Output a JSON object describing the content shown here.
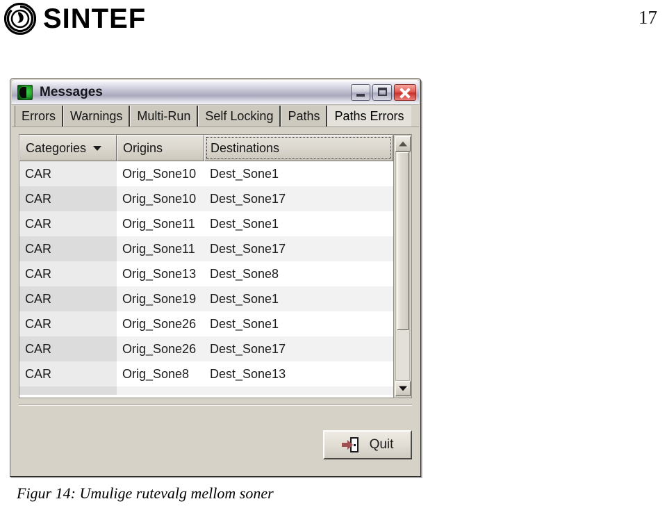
{
  "page": {
    "number": "17",
    "logo_text": "SINTEF",
    "caption": "Figur 14: Umulige rutevalg mellom soner"
  },
  "window": {
    "title": "Messages",
    "icon": "app-icon",
    "controls": {
      "minimize": "minimize-button",
      "maximize": "maximize-button",
      "close": "close-button"
    }
  },
  "tabs": [
    {
      "label": "Errors",
      "active": false
    },
    {
      "label": "Warnings",
      "active": false
    },
    {
      "label": "Multi-Run",
      "active": false
    },
    {
      "label": "Self Locking",
      "active": false
    },
    {
      "label": "Paths",
      "active": false
    },
    {
      "label": "Paths Errors",
      "active": true
    }
  ],
  "table": {
    "columns": [
      {
        "label": "Categories",
        "sorted": true,
        "focused": false
      },
      {
        "label": "Origins",
        "sorted": false,
        "focused": false
      },
      {
        "label": "Destinations",
        "sorted": false,
        "focused": true
      }
    ],
    "rows": [
      {
        "category": "CAR",
        "origin": "Orig_Sone10",
        "destination": "Dest_Sone1"
      },
      {
        "category": "CAR",
        "origin": "Orig_Sone10",
        "destination": "Dest_Sone17"
      },
      {
        "category": "CAR",
        "origin": "Orig_Sone11",
        "destination": "Dest_Sone1"
      },
      {
        "category": "CAR",
        "origin": "Orig_Sone11",
        "destination": "Dest_Sone17"
      },
      {
        "category": "CAR",
        "origin": "Orig_Sone13",
        "destination": "Dest_Sone8"
      },
      {
        "category": "CAR",
        "origin": "Orig_Sone19",
        "destination": "Dest_Sone1"
      },
      {
        "category": "CAR",
        "origin": "Orig_Sone26",
        "destination": "Dest_Sone1"
      },
      {
        "category": "CAR",
        "origin": "Orig_Sone26",
        "destination": "Dest_Sone17"
      },
      {
        "category": "CAR",
        "origin": "Orig_Sone8",
        "destination": "Dest_Sone13"
      },
      {
        "category": "",
        "origin": "",
        "destination": ""
      }
    ]
  },
  "scrollbar": {
    "up": "scroll-up-button",
    "down": "scroll-down-button",
    "thumb_position_percent": 0,
    "thumb_size_percent": 78
  },
  "footer": {
    "quit_label": "Quit",
    "quit_icon": "exit-door-icon"
  },
  "colors": {
    "window_face": "#d6d2c8",
    "title_bar": "#b9b9cb",
    "close_button": "#c9342c",
    "row_even": "#ffffff",
    "row_odd": "#f2f2f2",
    "category_even": "#ebebeb",
    "category_odd": "#dcdcdc"
  }
}
